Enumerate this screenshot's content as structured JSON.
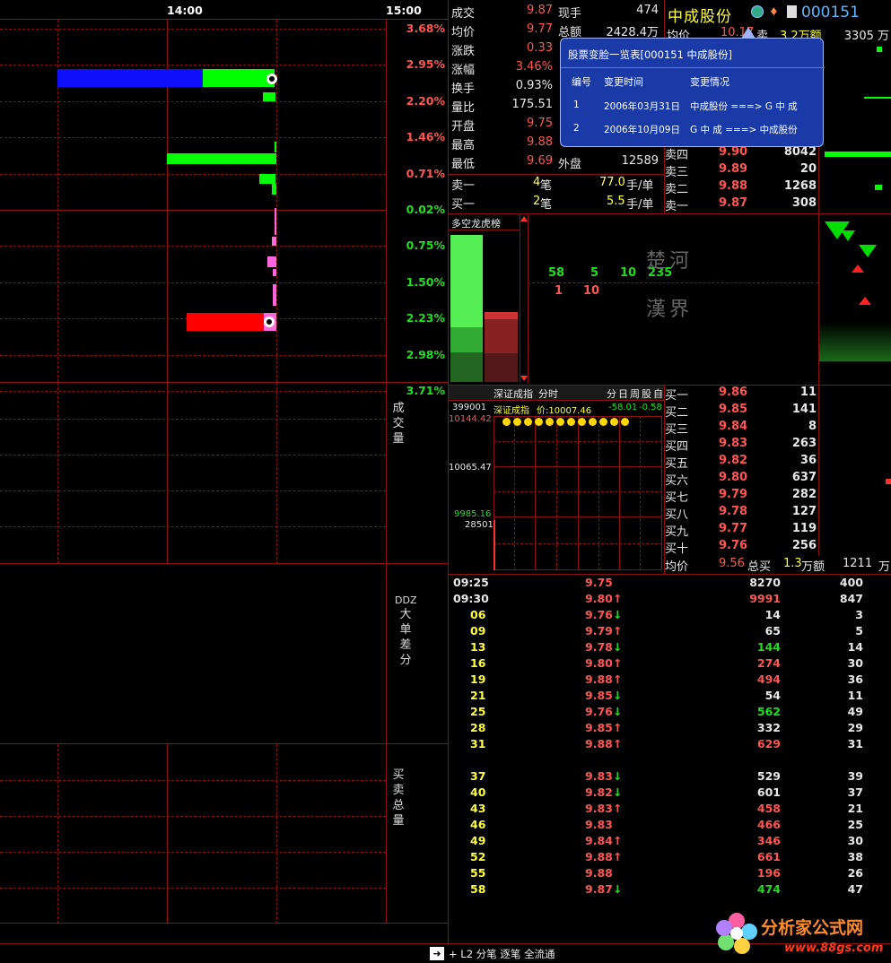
{
  "time_axis": {
    "t1": "14:00",
    "t2": "15:00"
  },
  "price_chart": {
    "pct_labels": [
      {
        "text": "3.68%",
        "color": "#ff5555"
      },
      {
        "text": "2.95%",
        "color": "#ff5555"
      },
      {
        "text": "2.20%",
        "color": "#ff5555"
      },
      {
        "text": "1.46%",
        "color": "#ff5555"
      },
      {
        "text": "0.71%",
        "color": "#ff5555"
      },
      {
        "text": "0.02%",
        "color": "#22dd22"
      },
      {
        "text": "0.75%",
        "color": "#22dd22"
      },
      {
        "text": "1.50%",
        "color": "#22dd22"
      },
      {
        "text": "2.23%",
        "color": "#22dd22"
      },
      {
        "text": "2.98%",
        "color": "#22dd22"
      },
      {
        "text": "3.71%",
        "color": "#22dd22"
      }
    ]
  },
  "indicator_labels": {
    "volume": "成交量",
    "ddz_prefix": "DDZ",
    "ddz": "大单差分",
    "buysell": "买卖总量"
  },
  "quote": {
    "stock_name": "中成股份",
    "stock_code": "000151",
    "rows_left": [
      {
        "label": "成交",
        "value": "9.87",
        "color": "#ff5555"
      },
      {
        "label": "均价",
        "value": "9.77",
        "color": "#ff5555"
      },
      {
        "label": "涨跌",
        "value": "0.33",
        "color": "#ff5555"
      },
      {
        "label": "涨幅",
        "value": "3.46%",
        "color": "#ff5555"
      },
      {
        "label": "换手",
        "value": "0.93%",
        "color": "#e8e8e8"
      },
      {
        "label": "量比",
        "value": "175.51",
        "color": "#e8e8e8"
      },
      {
        "label": "开盘",
        "value": "9.75",
        "color": "#ff5555"
      },
      {
        "label": "最高",
        "value": "9.88",
        "color": "#ff5555"
      },
      {
        "label": "最低",
        "value": "9.69",
        "color": "#ff5555"
      }
    ],
    "now_hand_label": "现手",
    "now_hand": "474",
    "total_amount_label": "总额",
    "total_amount": "2428.4万",
    "outer_label": "外盘",
    "outer": "12589",
    "avg_label": "均价",
    "avg_value": "10.17",
    "sell_amount_label": "卖",
    "sell_amount": "3.2万额",
    "sell_total": "3305 万",
    "sell1_label": "卖一",
    "sell1_count": "4",
    "sell1_unit": "笔",
    "sell1_avg": "77.0",
    "sell1_avg_unit": "手/单",
    "buy1_label": "买一",
    "buy1_count": "2",
    "buy1_unit": "笔",
    "buy1_avg": "5.5",
    "buy1_avg_unit": "手/单"
  },
  "ask_book": [
    {
      "label": "卖四",
      "price": "9.90",
      "vol": "8042"
    },
    {
      "label": "卖三",
      "price": "9.89",
      "vol": "20"
    },
    {
      "label": "卖二",
      "price": "9.88",
      "vol": "1268"
    },
    {
      "label": "卖一",
      "price": "9.87",
      "vol": "308"
    }
  ],
  "popup": {
    "title": "股票变脸一览表[000151  中成股份]",
    "headers": [
      "编号",
      "变更时间",
      "变更情况"
    ],
    "rows": [
      [
        "1",
        "2006年03月31日",
        "中成股份 ===> G 中  成"
      ],
      [
        "2",
        "2006年10月09日",
        "G 中  成 ===> 中成股份"
      ]
    ]
  },
  "longshort": {
    "title": "多空龙虎榜",
    "nums_top": [
      "58",
      "5",
      "10",
      "235"
    ],
    "nums_bottom": [
      "1",
      "10"
    ],
    "chu": "楚河",
    "han": "漢界"
  },
  "index_chart": {
    "title": "深证成指",
    "tab_time": "分时",
    "tabs": [
      "分",
      "日",
      "周",
      "股",
      "自"
    ],
    "code": "399001",
    "info_name": "深证成指",
    "info_price": "价:10007.46",
    "info_change": "-58.01",
    "info_pct": "-0.58",
    "y_labels": [
      "10144.42",
      "10065.47",
      "9985.16"
    ],
    "vol_label": "28501"
  },
  "bid_book": [
    {
      "label": "买一",
      "price": "9.86",
      "vol": "11"
    },
    {
      "label": "买二",
      "price": "9.85",
      "vol": "141"
    },
    {
      "label": "买三",
      "price": "9.84",
      "vol": "8"
    },
    {
      "label": "买四",
      "price": "9.83",
      "vol": "263"
    },
    {
      "label": "买五",
      "price": "9.82",
      "vol": "36"
    },
    {
      "label": "买六",
      "price": "9.80",
      "vol": "637"
    },
    {
      "label": "买七",
      "price": "9.79",
      "vol": "282"
    },
    {
      "label": "买八",
      "price": "9.78",
      "vol": "127"
    },
    {
      "label": "买九",
      "price": "9.77",
      "vol": "119"
    },
    {
      "label": "买十",
      "price": "9.76",
      "vol": "256"
    }
  ],
  "bid_summary": {
    "avg_label": "均价",
    "avg": "9.56",
    "total_label": "总买",
    "total": "1.3",
    "total_unit": "万额",
    "amount": "1211",
    "amount_unit": "万"
  },
  "ticks": [
    {
      "time": "09:25",
      "price": "9.75",
      "arrow": "",
      "vol": "8270",
      "n": "400",
      "tc": "#e8e8e8",
      "pc": "#ff5555",
      "vc": "#e8e8e8"
    },
    {
      "time": "09:30",
      "price": "9.80",
      "arrow": "↑",
      "vol": "9991",
      "n": "847",
      "tc": "#e8e8e8",
      "pc": "#ff5555",
      "vc": "#ff5555"
    },
    {
      "time": "06",
      "price": "9.76",
      "arrow": "↓",
      "vol": "14",
      "n": "3",
      "tc": "#ffff40",
      "pc": "#ff5555",
      "vc": "#e8e8e8"
    },
    {
      "time": "09",
      "price": "9.79",
      "arrow": "↑",
      "vol": "65",
      "n": "5",
      "tc": "#ffff40",
      "pc": "#ff5555",
      "vc": "#e8e8e8"
    },
    {
      "time": "13",
      "price": "9.78",
      "arrow": "↓",
      "vol": "144",
      "n": "14",
      "tc": "#ffff40",
      "pc": "#ff5555",
      "vc": "#22dd22"
    },
    {
      "time": "16",
      "price": "9.80",
      "arrow": "↑",
      "vol": "274",
      "n": "30",
      "tc": "#ffff40",
      "pc": "#ff5555",
      "vc": "#ff5555"
    },
    {
      "time": "19",
      "price": "9.88",
      "arrow": "↑",
      "vol": "494",
      "n": "36",
      "tc": "#ffff40",
      "pc": "#ff5555",
      "vc": "#ff5555"
    },
    {
      "time": "21",
      "price": "9.85",
      "arrow": "↓",
      "vol": "54",
      "n": "11",
      "tc": "#ffff40",
      "pc": "#ff5555",
      "vc": "#e8e8e8"
    },
    {
      "time": "25",
      "price": "9.76",
      "arrow": "↓",
      "vol": "562",
      "n": "49",
      "tc": "#ffff40",
      "pc": "#ff5555",
      "vc": "#22dd22"
    },
    {
      "time": "28",
      "price": "9.85",
      "arrow": "↑",
      "vol": "332",
      "n": "29",
      "tc": "#ffff40",
      "pc": "#ff5555",
      "vc": "#e8e8e8"
    },
    {
      "time": "31",
      "price": "9.88",
      "arrow": "↑",
      "vol": "629",
      "n": "31",
      "tc": "#ffff40",
      "pc": "#ff5555",
      "vc": "#ff5555"
    },
    {
      "time": "37",
      "price": "9.83",
      "arrow": "↓",
      "vol": "529",
      "n": "39",
      "tc": "#ffff40",
      "pc": "#ff5555",
      "vc": "#e8e8e8"
    },
    {
      "time": "40",
      "price": "9.82",
      "arrow": "↓",
      "vol": "601",
      "n": "37",
      "tc": "#ffff40",
      "pc": "#ff5555",
      "vc": "#e8e8e8"
    },
    {
      "time": "43",
      "price": "9.83",
      "arrow": "↑",
      "vol": "458",
      "n": "21",
      "tc": "#ffff40",
      "pc": "#ff5555",
      "vc": "#ff5555"
    },
    {
      "time": "46",
      "price": "9.83",
      "arrow": "",
      "vol": "466",
      "n": "25",
      "tc": "#ffff40",
      "pc": "#ff5555",
      "vc": "#ff5555"
    },
    {
      "time": "49",
      "price": "9.84",
      "arrow": "↑",
      "vol": "346",
      "n": "30",
      "tc": "#ffff40",
      "pc": "#ff5555",
      "vc": "#ff5555"
    },
    {
      "time": "52",
      "price": "9.88",
      "arrow": "↑",
      "vol": "661",
      "n": "38",
      "tc": "#ffff40",
      "pc": "#ff5555",
      "vc": "#ff5555"
    },
    {
      "time": "55",
      "price": "9.88",
      "arrow": "",
      "vol": "196",
      "n": "26",
      "tc": "#ffff40",
      "pc": "#ff5555",
      "vc": "#ff5555"
    },
    {
      "time": "58",
      "price": "9.87",
      "arrow": "↓",
      "vol": "474",
      "n": "47",
      "tc": "#ffff40",
      "pc": "#ff5555",
      "vc": "#22dd22"
    }
  ],
  "bottom_bar": {
    "text": "+ L2 分笔 逐笔 全流通"
  },
  "watermark": {
    "name": "分析家公式网",
    "url": "www.88gs.com"
  },
  "colors": {
    "grid": "#8b1010",
    "up": "#ff5555",
    "down": "#22dd22",
    "popup_bg": "#1a3aa8"
  }
}
